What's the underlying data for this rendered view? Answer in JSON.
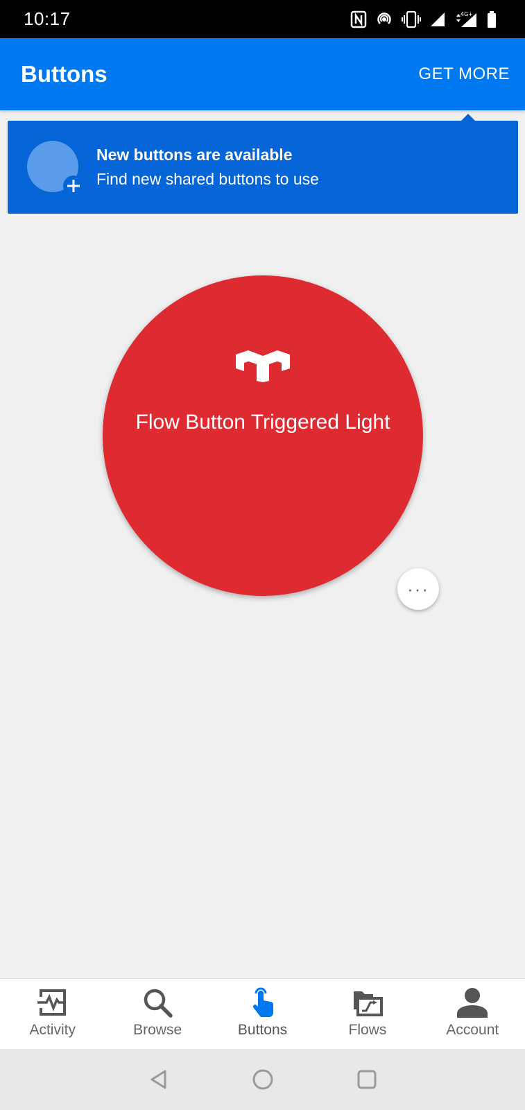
{
  "status_bar": {
    "time": "10:17",
    "icons": [
      "nfc-icon",
      "hotspot-icon",
      "vibrate-icon",
      "signal-icon",
      "signal-4g-icon",
      "battery-icon"
    ]
  },
  "app_bar": {
    "title": "Buttons",
    "action_label": "GET MORE"
  },
  "banner": {
    "title": "New buttons are available",
    "subtitle": "Find new shared buttons to use"
  },
  "flow_button": {
    "label": "Flow Button Triggered Light",
    "color": "#de2b32",
    "icon": "yeelight-logo"
  },
  "more_button": {
    "label": "···"
  },
  "bottom_nav": {
    "items": [
      {
        "label": "Activity",
        "icon": "activity-icon"
      },
      {
        "label": "Browse",
        "icon": "search-icon"
      },
      {
        "label": "Buttons",
        "icon": "touch-icon",
        "active": true
      },
      {
        "label": "Flows",
        "icon": "flows-icon"
      },
      {
        "label": "Account",
        "icon": "person-icon"
      }
    ]
  },
  "colors": {
    "primary": "#0078f0",
    "banner": "#0565d6",
    "active_icon": "#0078f0",
    "inactive_icon": "#555555"
  }
}
